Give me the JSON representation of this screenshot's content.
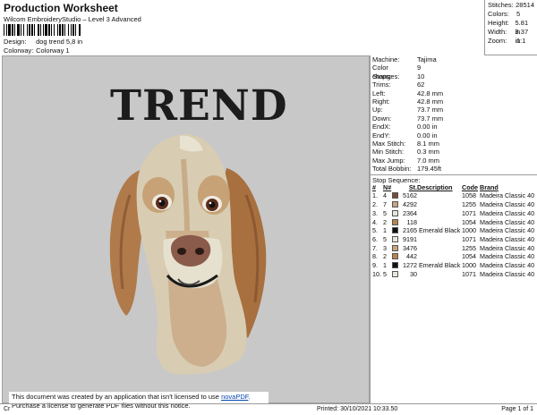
{
  "header": {
    "title": "Production Worksheet",
    "subtitle": "Wilcom EmbroideryStudio – Level 3 Advanced",
    "design_label": "Design:",
    "design_value": "dog  trend 5,8 in",
    "colorway_label": "Colorway:",
    "colorway_value": "Colorway 1"
  },
  "stats": [
    {
      "label": "Stitches:",
      "value": "28514"
    },
    {
      "label": "Colors:",
      "value": "5"
    },
    {
      "label": "Height:",
      "value": "5.81 in"
    },
    {
      "label": "Width:",
      "value": "3.37 in"
    },
    {
      "label": "Zoom:",
      "value": "1:1"
    }
  ],
  "design": {
    "text": "TREND",
    "background_color": "#c8c8c8"
  },
  "machine_info": [
    {
      "label": "Machine:",
      "value": "Tajima"
    },
    {
      "label": "Color changes:",
      "value": "9"
    },
    {
      "label": "Stops:",
      "value": "10"
    },
    {
      "label": "Trims:",
      "value": "62"
    },
    {
      "label": "Left:",
      "value": "42.8 mm"
    },
    {
      "label": "Right:",
      "value": "42.8 mm"
    },
    {
      "label": "Up:",
      "value": "73.7 mm"
    },
    {
      "label": "Down:",
      "value": "73.7 mm"
    },
    {
      "label": "EndX:",
      "value": "0.00 in"
    },
    {
      "label": "EndY:",
      "value": "0.00 in"
    },
    {
      "label": "Max Stitch:",
      "value": "8.1 mm"
    },
    {
      "label": "Min Stitch:",
      "value": "0.3 mm"
    },
    {
      "label": "Max Jump:",
      "value": "7.0 mm"
    },
    {
      "label": "Total Bobbin:",
      "value": "179.45ft"
    }
  ],
  "stop_sequence": {
    "title": "Stop Sequence:",
    "headers": [
      "#",
      "N#",
      "St.",
      "Description",
      "Code",
      "Brand"
    ],
    "rows": [
      {
        "num": "1.",
        "n": "4",
        "color": "#7a4a3a",
        "st": "5162",
        "desc": "",
        "code": "1058",
        "brand": "Madeira Classic 40"
      },
      {
        "num": "2.",
        "n": "7",
        "color": "#c9a27e",
        "st": "4292",
        "desc": "",
        "code": "1255",
        "brand": "Madeira Classic 40"
      },
      {
        "num": "3.",
        "n": "5",
        "color": "#e6e6dc",
        "st": "2364",
        "desc": "",
        "code": "1071",
        "brand": "Madeira Classic 40"
      },
      {
        "num": "4.",
        "n": "2",
        "color": "#b9824f",
        "st": "118",
        "desc": "",
        "code": "1054",
        "brand": "Madeira Classic 40"
      },
      {
        "num": "5.",
        "n": "1",
        "color": "#111111",
        "st": "2165",
        "desc": "Emerald Black",
        "code": "1000",
        "brand": "Madeira Classic 40"
      },
      {
        "num": "6.",
        "n": "5",
        "color": "#e6e6dc",
        "st": "9191",
        "desc": "",
        "code": "1071",
        "brand": "Madeira Classic 40"
      },
      {
        "num": "7.",
        "n": "3",
        "color": "#c9a27e",
        "st": "3476",
        "desc": "",
        "code": "1255",
        "brand": "Madeira Classic 40"
      },
      {
        "num": "8.",
        "n": "2",
        "color": "#b9824f",
        "st": "442",
        "desc": "",
        "code": "1054",
        "brand": "Madeira Classic 40"
      },
      {
        "num": "9.",
        "n": "1",
        "color": "#111111",
        "st": "1272",
        "desc": "Emerald Black",
        "code": "1000",
        "brand": "Madeira Classic 40"
      },
      {
        "num": "10.",
        "n": "5",
        "color": "#e6e6dc",
        "st": "30",
        "desc": "",
        "code": "1071",
        "brand": "Madeira Classic 40"
      }
    ]
  },
  "notice": {
    "line1_prefix": "This document was created by an application that isn't licensed to use ",
    "link_text": "novaPDF",
    "line1_suffix": ".",
    "line2": "Purchase a license to generate PDF files without this notice."
  },
  "footer": {
    "left": "Cr",
    "printed": "Printed: 30/10/2021 10:33.50",
    "page": "Page 1 of 1"
  }
}
